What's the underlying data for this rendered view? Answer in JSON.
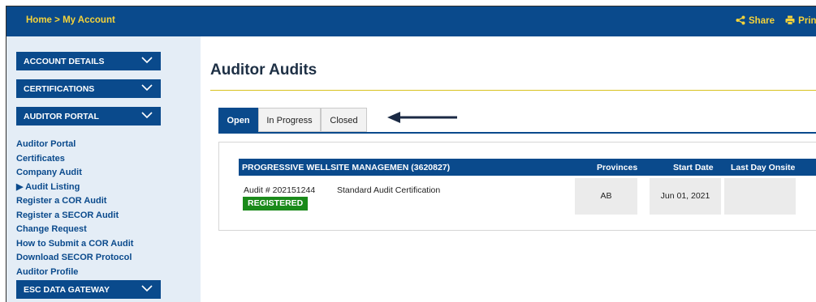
{
  "header": {
    "breadcrumb_home": "Home",
    "breadcrumb_sep": " > ",
    "breadcrumb_current": "My Account",
    "share_label": "Share",
    "print_label": "Print"
  },
  "sidebar": {
    "sections": [
      {
        "label": "ACCOUNT DETAILS"
      },
      {
        "label": "CERTIFICATIONS"
      },
      {
        "label": "AUDITOR PORTAL"
      },
      {
        "label": "ESC DATA GATEWAY"
      }
    ],
    "links": [
      {
        "label": "Auditor Portal"
      },
      {
        "label": "Certificates"
      },
      {
        "label": "Company Audit"
      },
      {
        "label": "▶ Audit Listing"
      },
      {
        "label": "Register a COR Audit"
      },
      {
        "label": "Register a SECOR Audit"
      },
      {
        "label": "Change Request"
      },
      {
        "label": "How to Submit a COR Audit"
      },
      {
        "label": "Download SECOR Protocol"
      },
      {
        "label": "Auditor Profile"
      }
    ]
  },
  "main": {
    "title": "Auditor Audits",
    "tabs": [
      {
        "label": "Open",
        "active": true
      },
      {
        "label": "In Progress",
        "active": false
      },
      {
        "label": "Closed",
        "active": false
      }
    ],
    "table": {
      "company": "PROGRESSIVE WELLSITE MANAGEMEN (3620827)",
      "col_provinces": "Provinces",
      "col_start_date": "Start Date",
      "col_last_day": "Last Day Onsite",
      "rows": [
        {
          "audit_number": "Audit # 202151244",
          "audit_type": "Standard Audit Certification",
          "status": "REGISTERED",
          "province": "AB",
          "start_date": "Jun 01, 2021",
          "last_day": ""
        }
      ]
    }
  },
  "colors": {
    "brand_blue": "#0a4a8c",
    "accent_yellow": "#f5d33a",
    "status_green": "#1a8a1a",
    "arrow": "#1b2a44"
  },
  "icons": {
    "share": "share-icon",
    "print": "printer-icon",
    "chevron": "chevron-down-icon",
    "arrow": "arrow-left-icon"
  }
}
